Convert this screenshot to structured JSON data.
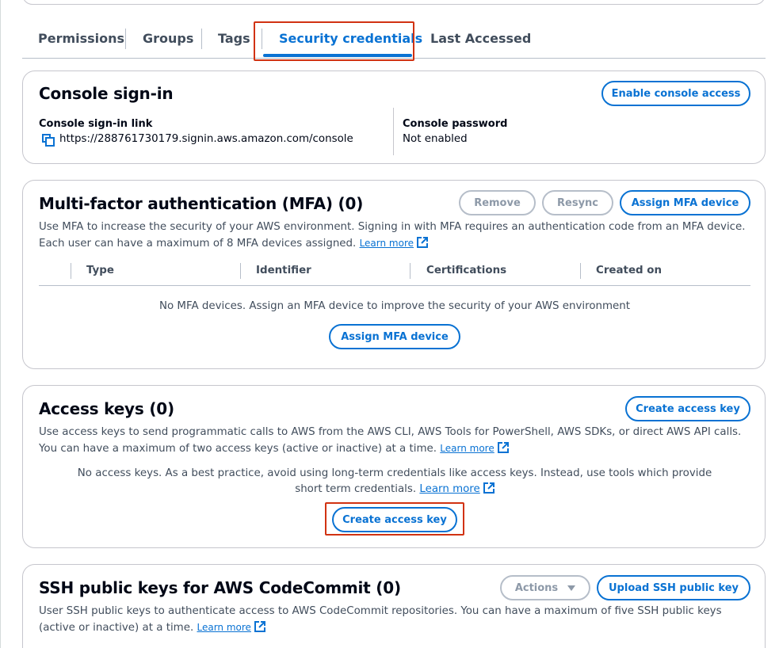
{
  "tabs": [
    {
      "label": "Permissions"
    },
    {
      "label": "Groups"
    },
    {
      "label": "Tags"
    },
    {
      "label": "Security credentials",
      "active": true
    },
    {
      "label": "Last Accessed"
    }
  ],
  "console_signin": {
    "title": "Console sign-in",
    "enable_button": "Enable console access",
    "link_label": "Console sign-in link",
    "link_value": "https://288761730179.signin.aws.amazon.com/console",
    "password_label": "Console password",
    "password_value": "Not enabled"
  },
  "mfa": {
    "title": "Multi-factor authentication (MFA) (0)",
    "remove_button": "Remove",
    "resync_button": "Resync",
    "assign_button": "Assign MFA device",
    "description": "Use MFA to increase the security of your AWS environment. Signing in with MFA requires an authentication code from an MFA device. Each user can have a maximum of 8 MFA devices assigned.",
    "learn_more": "Learn more",
    "columns": [
      "Type",
      "Identifier",
      "Certifications",
      "Created on"
    ],
    "empty_text": "No MFA devices. Assign an MFA device to improve the security of your AWS environment",
    "empty_button": "Assign MFA device"
  },
  "access_keys": {
    "title": "Access keys (0)",
    "create_button": "Create access key",
    "description": "Use access keys to send programmatic calls to AWS from the AWS CLI, AWS Tools for PowerShell, AWS SDKs, or direct AWS API calls. You can have a maximum of two access keys (active or inactive) at a time.",
    "learn_more": "Learn more",
    "empty_text": "No access keys. As a best practice, avoid using long-term credentials like access keys. Instead, use tools which provide short term credentials.",
    "empty_learn_more": "Learn more",
    "empty_button": "Create access key"
  },
  "ssh": {
    "title": "SSH public keys for AWS CodeCommit (0)",
    "actions_button": "Actions",
    "upload_button": "Upload SSH public key",
    "description": "User SSH public keys to authenticate access to AWS CodeCommit repositories. You can have a maximum of five SSH public keys (active or inactive) at a time.",
    "learn_more": "Learn more"
  },
  "colors": {
    "accent": "#0972d3",
    "highlight": "#d13212",
    "disabled": "#8d99a8"
  },
  "icons": {
    "copy": "copy-icon",
    "external": "external-link-icon",
    "caret": "caret-down-icon"
  }
}
